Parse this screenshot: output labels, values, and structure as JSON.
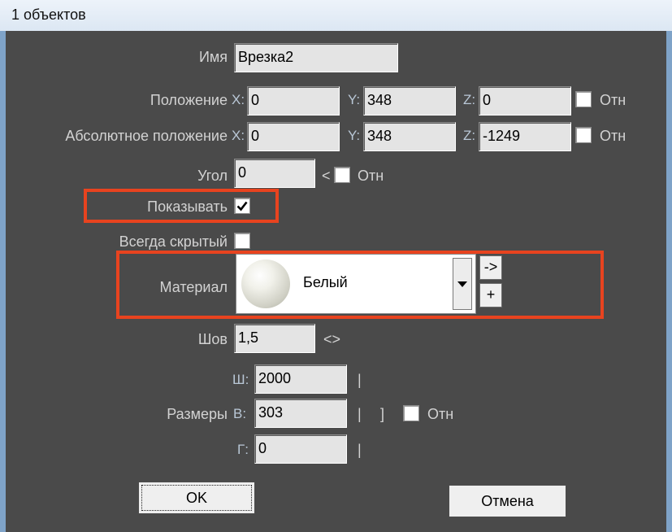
{
  "window": {
    "title": "1 объектов"
  },
  "form": {
    "name": {
      "label": "Имя",
      "value": "Врезка2"
    },
    "position": {
      "label": "Положение",
      "x_label": "X:",
      "x": "0",
      "y_label": "Y:",
      "y": "348",
      "z_label": "Z:",
      "z": "0",
      "rel_label": "Отн",
      "rel_checked": false
    },
    "abs_position": {
      "label": "Абсолютное положение",
      "x_label": "X:",
      "x": "0",
      "y_label": "Y:",
      "y": "348",
      "z_label": "Z:",
      "z": "-1249",
      "rel_label": "Отн",
      "rel_checked": false
    },
    "angle": {
      "label": "Угол",
      "value": "0",
      "arrow": "<",
      "rel_label": "Отн",
      "rel_checked": false
    },
    "show": {
      "label": "Показывать",
      "checked": true
    },
    "always_hidden": {
      "label": "Всегда скрытый",
      "checked": false
    },
    "material": {
      "label": "Материал",
      "value": "Белый",
      "goto_label": "->",
      "add_label": "+"
    },
    "seam": {
      "label": "Шов",
      "value": "1,5",
      "arrows": "<>"
    },
    "sizes": {
      "label": "Размеры",
      "w_label": "Ш:",
      "w": "2000",
      "h_label": "В:",
      "h": "303",
      "d_label": "Г:",
      "d": "0",
      "bar": "|",
      "bracket": "]",
      "rel_label": "Отн",
      "rel_checked": false
    }
  },
  "buttons": {
    "ok": "OK",
    "cancel": "Отмена"
  },
  "colors": {
    "highlight": "#e8431f",
    "panel": "#4a4a4a"
  }
}
